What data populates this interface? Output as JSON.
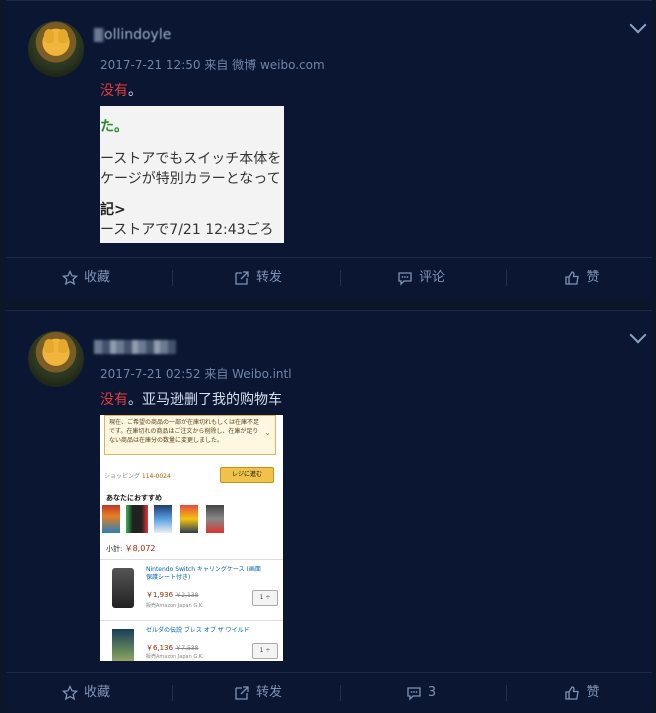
{
  "posts": [
    {
      "username": "ollindoyle",
      "timestamp": "2017-7-21 12:50",
      "source": "来自 微博 weibo.com",
      "text_red": "没有",
      "text_rest": "。",
      "image_lines": [
        "た。",
        "ーストアでもスイッチ本体を",
        "ケージが特別カラーとなって",
        "記>",
        "ーストアで7/21 12:43ごろ"
      ],
      "actions": {
        "favorite": "收藏",
        "repost": "转发",
        "comment": "评论",
        "like": "赞"
      }
    },
    {
      "timestamp": "2017-7-21 02:52",
      "source": "来自 Weibo.intl",
      "text_red": "没有",
      "text_rest": "。亚马逊删了我的购物车",
      "screenshot": {
        "notice": "現在、ご希望の商品の一部が在庫切れもしくは在庫不足です。在庫切れの商品はご注文から削除し、在庫が足りない商品は在庫分の数量に変更しました。",
        "shipping_label": "ショッピング ",
        "zip": "114-0024",
        "checkout": "レジに進む",
        "recommend": "あなたにおすすめ",
        "subtotal_label": "小計: ",
        "subtotal": "￥8,072",
        "items": [
          {
            "title": "Nintendo Switch キャリングケース (画面保護シート付き)",
            "price": "￥1,936",
            "old": "￥2,138",
            "seller": "販売Amazon Japan G.K.",
            "qty": "1 ÷"
          },
          {
            "title": "ゼルダの伝説 ブレス オブ ザ ワイルド",
            "price": "￥6,136",
            "old": "￥7,538",
            "seller": "販売Amazon Japan G.K.",
            "qty": "1 ÷"
          }
        ]
      },
      "actions": {
        "favorite": "收藏",
        "repost": "转发",
        "comment": "3",
        "like": "赞"
      }
    }
  ]
}
